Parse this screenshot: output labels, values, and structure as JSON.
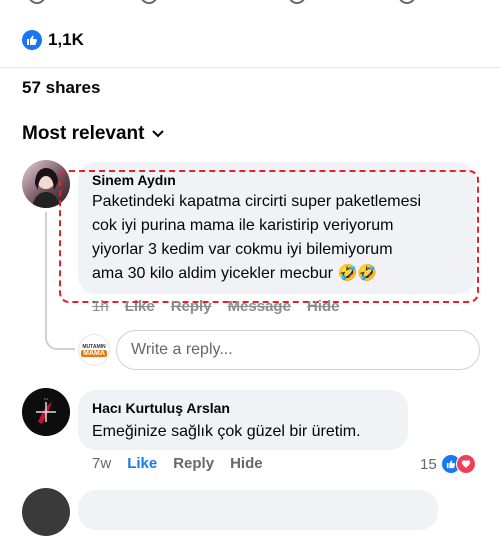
{
  "post": {
    "reactions_count": "1,1K",
    "shares": "57 shares",
    "sort_label": "Most relevant"
  },
  "comments": [
    {
      "author": "Sinem Aydın",
      "lines": [
        "Paketindeki kapatma circirti super paketlemesi",
        "cok iyi purina mama ile karistirip veriyorum",
        "yiyorlar 3 kedim var  cokmu iyi bilemiyorum",
        "ama 30 kilo aldim yicekler mecbur"
      ],
      "emoji": "🤣🤣",
      "time": "1h",
      "like": "Like",
      "reply": "Reply",
      "message": "Message",
      "hide": "Hide"
    },
    {
      "author": "Hacı Kurtuluş Arslan",
      "text": "Emeğinize sağlık çok güzel bir üretim.",
      "time": "7w",
      "like": "Like",
      "reply": "Reply",
      "hide": "Hide",
      "reaction_count": "15"
    }
  ],
  "reply_box": {
    "placeholder": "Write a reply...",
    "avatar_top": "MUTAMIN",
    "avatar_bottom": "MAMA"
  },
  "colors": {
    "accent": "#1877f2",
    "highlight": "#e0242c",
    "bubble": "#f0f2f5",
    "love": "#f33e58"
  },
  "icons": [
    "like-icon",
    "chevron-down-icon",
    "love-icon"
  ]
}
